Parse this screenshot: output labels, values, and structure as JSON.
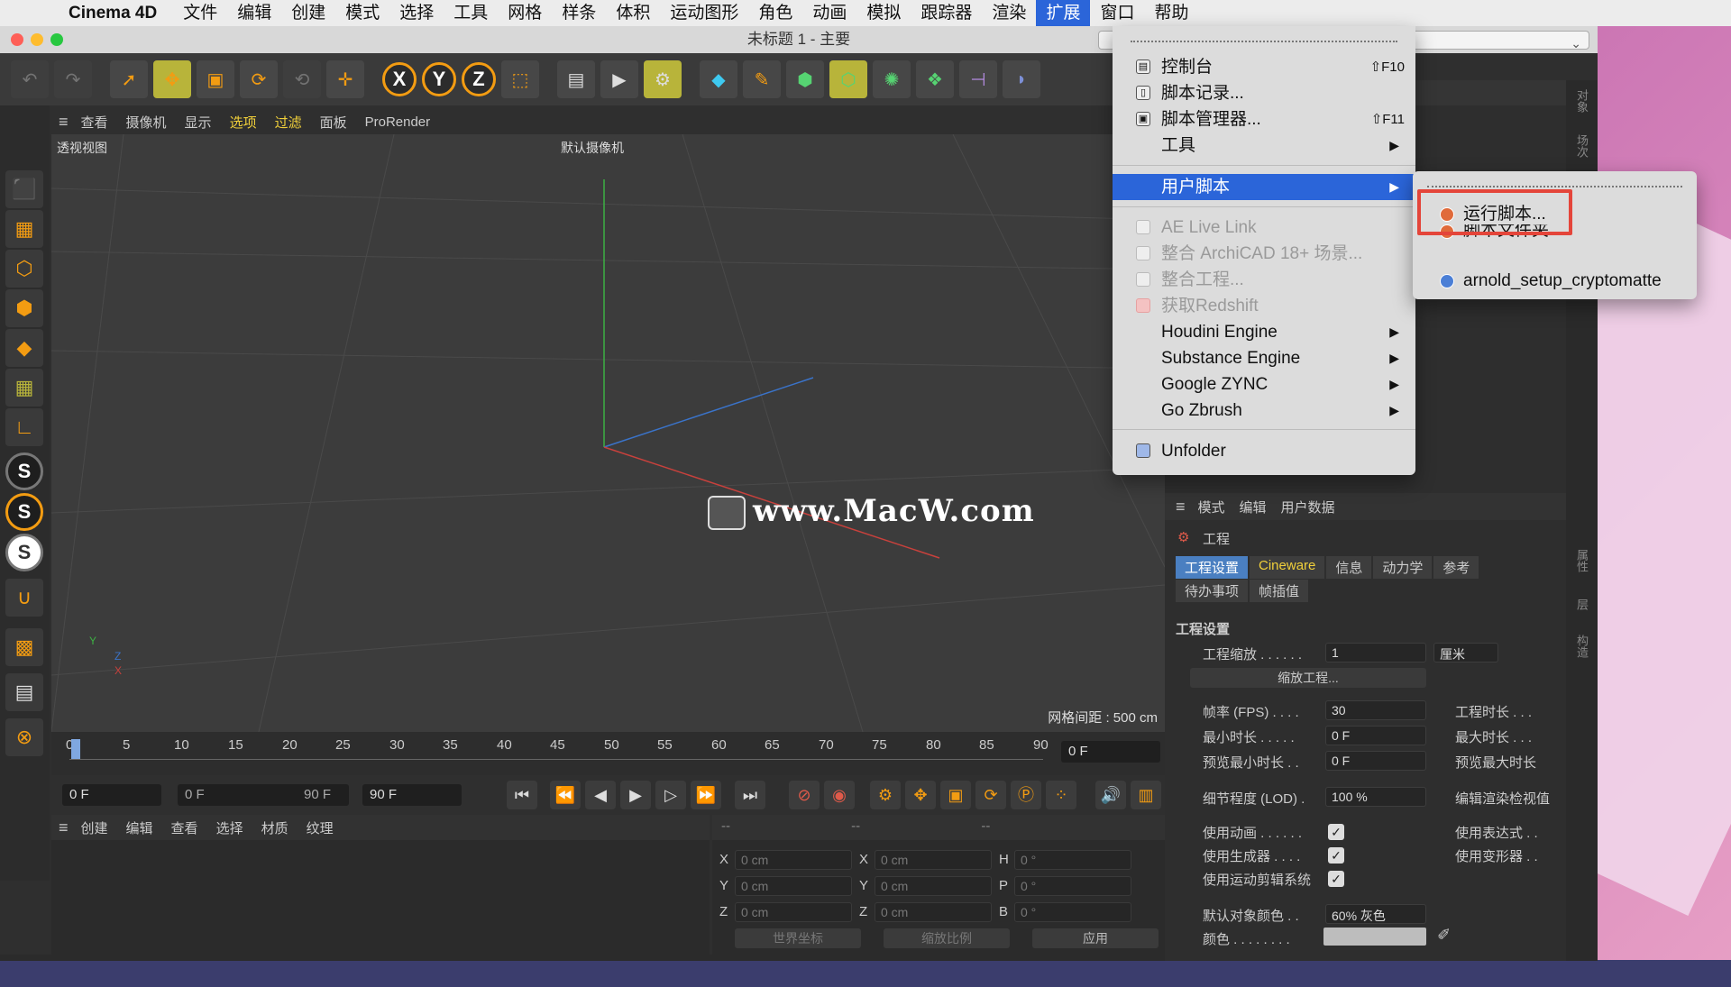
{
  "menubar": {
    "app": "Cinema 4D",
    "items": [
      "文件",
      "编辑",
      "创建",
      "模式",
      "选择",
      "工具",
      "网格",
      "样条",
      "体积",
      "运动图形",
      "角色",
      "动画",
      "模拟",
      "跟踪器",
      "渲染",
      "扩展",
      "窗口",
      "帮助"
    ],
    "active": "扩展"
  },
  "window": {
    "title": "未标题 1 - 主要"
  },
  "viewport": {
    "menu": [
      "查看",
      "摄像机",
      "显示",
      "选项",
      "过滤",
      "面板",
      "ProRender"
    ],
    "label": "透视视图",
    "camera": "默认摄像机",
    "grid_info": "网格间距 : 500 cm",
    "watermark": "www.MacW.com",
    "axis": {
      "y": "Y",
      "z": "Z",
      "x": "X"
    }
  },
  "timeline": {
    "ticks": [
      "0",
      "5",
      "10",
      "15",
      "20",
      "25",
      "30",
      "35",
      "40",
      "45",
      "50",
      "55",
      "60",
      "65",
      "70",
      "75",
      "80",
      "85",
      "90"
    ],
    "current_frame": "0 F",
    "start": "0 F",
    "range_start": "0 F",
    "range_end": "90 F",
    "end": "90 F"
  },
  "material_manager": {
    "menu": [
      "创建",
      "编辑",
      "查看",
      "选择",
      "材质",
      "纹理"
    ]
  },
  "coordinates": {
    "header": "--",
    "rows": [
      {
        "l1": "X",
        "v1": "0 cm",
        "l2": "X",
        "v2": "0 cm",
        "l3": "H",
        "v3": "0 °"
      },
      {
        "l1": "Y",
        "v1": "0 cm",
        "l2": "Y",
        "v2": "0 cm",
        "l3": "P",
        "v3": "0 °"
      },
      {
        "l1": "Z",
        "v1": "0 cm",
        "l2": "Z",
        "v2": "0 cm",
        "l3": "B",
        "v3": "0 °"
      }
    ],
    "coord_system": "世界坐标",
    "scale_mode": "缩放比例",
    "apply": "应用"
  },
  "attributes": {
    "menu": [
      "模式",
      "编辑",
      "用户数据"
    ],
    "object": "工程",
    "tabs": [
      "工程设置",
      "Cineware",
      "信息",
      "动力学",
      "参考"
    ],
    "tabs2": [
      "待办事项",
      "帧插值"
    ],
    "section": "工程设置",
    "scale_label": "工程缩放 . . . . . .",
    "scale_value": "1",
    "scale_unit": "厘米",
    "scale_btn": "缩放工程...",
    "fps_label": "帧率 (FPS) . . . .",
    "fps_value": "30",
    "duration_label": "工程时长 . . .",
    "min_label": "最小时长 . . . . .",
    "min_value": "0 F",
    "max_label": "最大时长 . . .",
    "pmin_label": "预览最小时长 . .",
    "pmin_value": "0 F",
    "pmax_label": "预览最大时长",
    "lod_label": "细节程度 (LOD) .",
    "lod_value": "100 %",
    "lod_right": "编辑渲染检视值",
    "anim_label": "使用动画 . . . . . .",
    "gen_label": "使用生成器 . . . .",
    "motion_label": "使用运动剪辑系统",
    "expr_label": "使用表达式 . .",
    "deform_label": "使用变形器 . .",
    "objcolor_label": "默认对象颜色 . .",
    "objcolor_value": "60% 灰色",
    "color_label": "颜色 . . . . . . . ."
  },
  "right_strip": [
    "对象",
    "场次",
    "内容",
    "属性",
    "层",
    "构造"
  ],
  "dropdown": {
    "items": [
      {
        "label": "控制台",
        "shortcut": "⇧F10"
      },
      {
        "label": "脚本记录..."
      },
      {
        "label": "脚本管理器...",
        "shortcut": "⇧F11"
      },
      {
        "label": "工具"
      },
      {
        "label": "用户脚本"
      },
      {
        "label": "AE Live Link"
      },
      {
        "label": "整合 ArchiCAD 18+ 场景..."
      },
      {
        "label": "整合工程..."
      },
      {
        "label": "获取Redshift"
      },
      {
        "label": "Houdini Engine"
      },
      {
        "label": "Substance Engine"
      },
      {
        "label": "Google ZYNC"
      },
      {
        "label": "Go Zbrush"
      },
      {
        "label": "Unfolder"
      }
    ]
  },
  "submenu": {
    "items": [
      {
        "label": "运行脚本..."
      },
      {
        "label": "脚本文件夹..."
      },
      {
        "label": "arnold_setup_cryptomatte"
      }
    ]
  },
  "colors": {
    "menu_highlight": "#2b65d9",
    "callout_red": "#e4453a",
    "accent_orange": "#f39c12"
  }
}
